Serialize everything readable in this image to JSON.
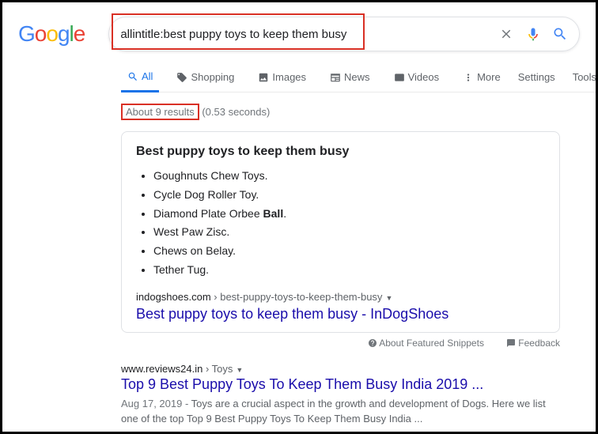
{
  "logo": {
    "c1": "G",
    "c2": "o",
    "c3": "o",
    "c4": "g",
    "c5": "l",
    "c6": "e"
  },
  "search": {
    "value": "allintitle:best puppy toys to keep them busy"
  },
  "tabs": {
    "all": "All",
    "shopping": "Shopping",
    "images": "Images",
    "news": "News",
    "videos": "Videos",
    "more": "More",
    "settings": "Settings",
    "tools": "Tools"
  },
  "stats": {
    "count": "About 9 results",
    "time": " (0.53 seconds)"
  },
  "featured": {
    "title": "Best puppy toys to keep them busy",
    "items": [
      "Goughnuts Chew Toys.",
      "Cycle Dog Roller Toy.",
      "Diamond Plate Orbee ",
      "West Paw Zisc.",
      "Chews on Belay.",
      "Tether Tug."
    ],
    "item2_bold": "Ball",
    "item2_tail": ".",
    "cite_domain": "indogshoes.com",
    "cite_path": " › best-puppy-toys-to-keep-them-busy",
    "link": "Best puppy toys to keep them busy - InDogShoes"
  },
  "snippet_actions": {
    "about": "About Featured Snippets",
    "feedback": "Feedback"
  },
  "result1": {
    "cite_domain": "www.reviews24.in",
    "cite_path": " › Toys",
    "title": "Top 9 Best Puppy Toys To Keep Them Busy India 2019 ...",
    "date": "Aug 17, 2019 - ",
    "snippet": "Toys are a crucial aspect in the growth and development of Dogs. Here we list one of the top Top 9 Best Puppy Toys To Keep Them Busy India ..."
  }
}
